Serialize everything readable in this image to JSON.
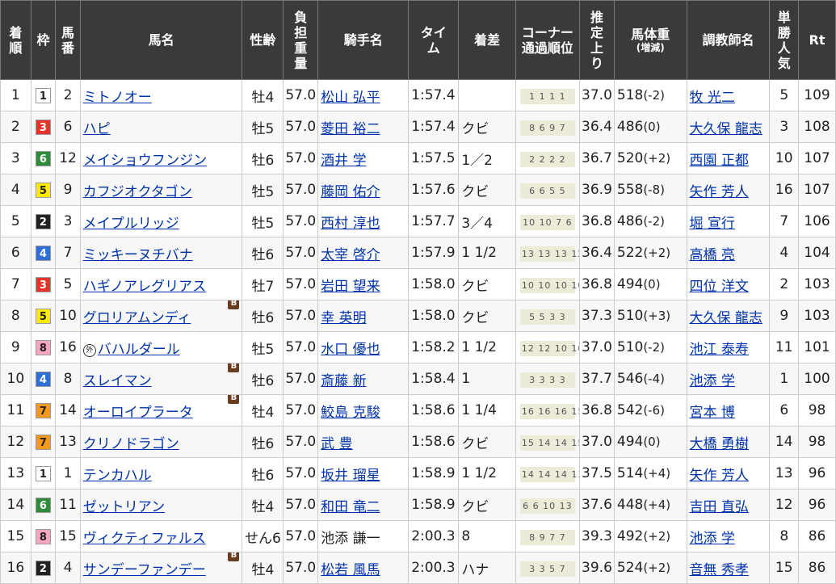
{
  "headers": {
    "rank": "着順",
    "waku": "枠",
    "umaban": "馬番",
    "horse_name": "馬名",
    "sex_age": "性齢",
    "weight_carried": "負担重量",
    "jockey": "騎手名",
    "time": "タイム",
    "margin": "着差",
    "corner_main": "コーナー",
    "corner_sub": "通過順位",
    "last3f": "推定上り",
    "body_weight_main": "馬体重",
    "body_weight_sub": "(増減)",
    "trainer": "調教師名",
    "popularity": "単勝人気",
    "rating": "Rt"
  },
  "blinkers_label": "B",
  "foreign_label": "外",
  "rows": [
    {
      "rank": "1",
      "waku": "1",
      "waku_bg": "#ffffff",
      "waku_fg": "#222222",
      "umaban": "2",
      "name": "ミトノオー",
      "blinkers": false,
      "foreign": false,
      "sex_age": "牡4",
      "kinryo": "57.0",
      "jockey": "松山 弘平",
      "jockey_link": true,
      "time": "1:57.4",
      "margin": "",
      "corner": "1 1 1 1",
      "last3f": "37.0",
      "weight": "518",
      "diff": "(-2)",
      "trainer": "牧 光二",
      "pop": "5",
      "rt": "109"
    },
    {
      "rank": "2",
      "waku": "3",
      "waku_bg": "#e8312a",
      "waku_fg": "#ffffff",
      "umaban": "6",
      "name": "ハピ",
      "blinkers": false,
      "foreign": false,
      "sex_age": "牡5",
      "kinryo": "57.0",
      "jockey": "菱田 裕二",
      "jockey_link": true,
      "time": "1:57.4",
      "margin": "クビ",
      "corner": "8 6 9 7",
      "last3f": "36.4",
      "weight": "486",
      "diff": "(0)",
      "trainer": "大久保 龍志",
      "pop": "3",
      "rt": "108"
    },
    {
      "rank": "3",
      "waku": "6",
      "waku_bg": "#2e8b3a",
      "waku_fg": "#ffffff",
      "umaban": "12",
      "name": "メイショウフンジン",
      "blinkers": false,
      "foreign": false,
      "sex_age": "牡6",
      "kinryo": "57.0",
      "jockey": "酒井 学",
      "jockey_link": true,
      "time": "1:57.5",
      "margin": "1／2",
      "corner": "2 2 2 2",
      "last3f": "36.7",
      "weight": "520",
      "diff": "(+2)",
      "trainer": "西園 正都",
      "pop": "10",
      "rt": "107"
    },
    {
      "rank": "4",
      "waku": "5",
      "waku_bg": "#ffeb00",
      "waku_fg": "#222222",
      "umaban": "9",
      "name": "カフジオクタゴン",
      "blinkers": false,
      "foreign": false,
      "sex_age": "牡5",
      "kinryo": "57.0",
      "jockey": "藤岡 佑介",
      "jockey_link": true,
      "time": "1:57.6",
      "margin": "クビ",
      "corner": "6 6 5 5",
      "last3f": "36.9",
      "weight": "558",
      "diff": "(-8)",
      "trainer": "矢作 芳人",
      "pop": "16",
      "rt": "107"
    },
    {
      "rank": "5",
      "waku": "2",
      "waku_bg": "#222222",
      "waku_fg": "#ffffff",
      "umaban": "3",
      "name": "メイプルリッジ",
      "blinkers": false,
      "foreign": false,
      "sex_age": "牡5",
      "kinryo": "57.0",
      "jockey": "西村 淳也",
      "jockey_link": true,
      "time": "1:57.7",
      "margin": "3／4",
      "corner": "10 10 7 6",
      "last3f": "36.8",
      "weight": "486",
      "diff": "(-2)",
      "trainer": "堀 宣行",
      "pop": "7",
      "rt": "106"
    },
    {
      "rank": "6",
      "waku": "4",
      "waku_bg": "#2f6fd6",
      "waku_fg": "#ffffff",
      "umaban": "7",
      "name": "ミッキーヌチバナ",
      "blinkers": false,
      "foreign": false,
      "sex_age": "牡6",
      "kinryo": "57.0",
      "jockey": "太宰 啓介",
      "jockey_link": true,
      "time": "1:57.9",
      "margin": "1 1/2",
      "corner": "13 13 13 12",
      "last3f": "36.4",
      "weight": "522",
      "diff": "(+2)",
      "trainer": "高橋 亮",
      "pop": "4",
      "rt": "104"
    },
    {
      "rank": "7",
      "waku": "3",
      "waku_bg": "#e8312a",
      "waku_fg": "#ffffff",
      "umaban": "5",
      "name": "ハギノアレグリアス",
      "blinkers": false,
      "foreign": false,
      "sex_age": "牡7",
      "kinryo": "57.0",
      "jockey": "岩田 望来",
      "jockey_link": true,
      "time": "1:58.0",
      "margin": "クビ",
      "corner": "10 10 10 10",
      "last3f": "36.8",
      "weight": "494",
      "diff": "(0)",
      "trainer": "四位 洋文",
      "pop": "2",
      "rt": "103"
    },
    {
      "rank": "8",
      "waku": "5",
      "waku_bg": "#ffeb00",
      "waku_fg": "#222222",
      "umaban": "10",
      "name": "グロリアムンディ",
      "blinkers": true,
      "foreign": false,
      "sex_age": "牡6",
      "kinryo": "57.0",
      "jockey": "幸 英明",
      "jockey_link": true,
      "time": "1:58.0",
      "margin": "クビ",
      "corner": "5 5 3 3",
      "last3f": "37.3",
      "weight": "510",
      "diff": "(+3)",
      "trainer": "大久保 龍志",
      "pop": "9",
      "rt": "103"
    },
    {
      "rank": "9",
      "waku": "8",
      "waku_bg": "#f7a6c0",
      "waku_fg": "#222222",
      "umaban": "16",
      "name": "バハルダール",
      "blinkers": false,
      "foreign": true,
      "sex_age": "牡5",
      "kinryo": "57.0",
      "jockey": "水口 優也",
      "jockey_link": true,
      "time": "1:58.2",
      "margin": "1 1/2",
      "corner": "12 12 10 10",
      "last3f": "37.0",
      "weight": "510",
      "diff": "(-2)",
      "trainer": "池江 泰寿",
      "pop": "11",
      "rt": "101"
    },
    {
      "rank": "10",
      "waku": "4",
      "waku_bg": "#2f6fd6",
      "waku_fg": "#ffffff",
      "umaban": "8",
      "name": "スレイマン",
      "blinkers": true,
      "foreign": false,
      "sex_age": "牡6",
      "kinryo": "57.0",
      "jockey": "斎藤 新",
      "jockey_link": true,
      "time": "1:58.4",
      "margin": "1",
      "corner": "3 3 3 3",
      "last3f": "37.7",
      "weight": "546",
      "diff": "(-4)",
      "trainer": "池添 学",
      "pop": "1",
      "rt": "100"
    },
    {
      "rank": "11",
      "waku": "7",
      "waku_bg": "#f39a1e",
      "waku_fg": "#222222",
      "umaban": "14",
      "name": "オーロイプラータ",
      "blinkers": true,
      "foreign": false,
      "sex_age": "牡4",
      "kinryo": "57.0",
      "jockey": "鮫島 克駿",
      "jockey_link": true,
      "time": "1:58.6",
      "margin": "1 1/4",
      "corner": "16 16 16 15",
      "last3f": "36.8",
      "weight": "542",
      "diff": "(-6)",
      "trainer": "宮本 博",
      "pop": "6",
      "rt": "98"
    },
    {
      "rank": "12",
      "waku": "7",
      "waku_bg": "#f39a1e",
      "waku_fg": "#222222",
      "umaban": "13",
      "name": "クリノドラゴン",
      "blinkers": false,
      "foreign": false,
      "sex_age": "牡6",
      "kinryo": "57.0",
      "jockey": "武 豊",
      "jockey_link": true,
      "time": "1:58.6",
      "margin": "クビ",
      "corner": "15 14 14 15",
      "last3f": "37.0",
      "weight": "494",
      "diff": "(0)",
      "trainer": "大橋 勇樹",
      "pop": "14",
      "rt": "98"
    },
    {
      "rank": "13",
      "waku": "1",
      "waku_bg": "#ffffff",
      "waku_fg": "#222222",
      "umaban": "1",
      "name": "テンカハル",
      "blinkers": false,
      "foreign": false,
      "sex_age": "牡6",
      "kinryo": "57.0",
      "jockey": "坂井 瑠星",
      "jockey_link": true,
      "time": "1:58.9",
      "margin": "1 1/2",
      "corner": "14 14 14 13",
      "last3f": "37.5",
      "weight": "514",
      "diff": "(+4)",
      "trainer": "矢作 芳人",
      "pop": "13",
      "rt": "96"
    },
    {
      "rank": "14",
      "waku": "6",
      "waku_bg": "#2e8b3a",
      "waku_fg": "#ffffff",
      "umaban": "11",
      "name": "ゼットリアン",
      "blinkers": false,
      "foreign": false,
      "sex_age": "牡4",
      "kinryo": "57.0",
      "jockey": "和田 竜二",
      "jockey_link": true,
      "time": "1:58.9",
      "margin": "クビ",
      "corner": "6 6 10 13",
      "last3f": "37.6",
      "weight": "448",
      "diff": "(+4)",
      "trainer": "吉田 直弘",
      "pop": "12",
      "rt": "96"
    },
    {
      "rank": "15",
      "waku": "8",
      "waku_bg": "#f7a6c0",
      "waku_fg": "#222222",
      "umaban": "15",
      "name": "ヴィクティファルス",
      "blinkers": false,
      "foreign": false,
      "sex_age": "せん6",
      "kinryo": "57.0",
      "jockey": "池添 謙一",
      "jockey_link": false,
      "time": "2:00.3",
      "margin": "8",
      "corner": "8 9 7 7",
      "last3f": "39.3",
      "weight": "492",
      "diff": "(+2)",
      "trainer": "池添 学",
      "pop": "8",
      "rt": "86"
    },
    {
      "rank": "16",
      "waku": "2",
      "waku_bg": "#222222",
      "waku_fg": "#ffffff",
      "umaban": "4",
      "name": "サンデーファンデー",
      "blinkers": true,
      "foreign": false,
      "sex_age": "牡4",
      "kinryo": "57.0",
      "jockey": "松若 風馬",
      "jockey_link": true,
      "time": "2:00.3",
      "margin": "ハナ",
      "corner": "3 3 5 7",
      "last3f": "39.6",
      "weight": "524",
      "diff": "(+2)",
      "trainer": "音無 秀孝",
      "pop": "15",
      "rt": "86"
    }
  ]
}
